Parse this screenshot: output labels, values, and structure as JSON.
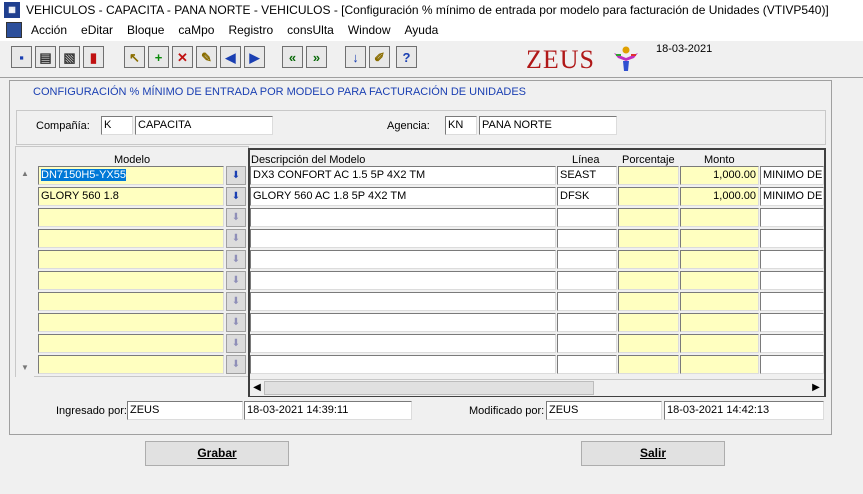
{
  "window": {
    "title": "VEHICULOS - CAPACITA - PANA NORTE - VEHICULOS - [Configuración % mínimo de entrada por modelo para facturación de Unidades (VTIVP540)]"
  },
  "menu": [
    "Acción",
    "eDitar",
    "Bloque",
    "caMpo",
    "Registro",
    "consUlta",
    "Window",
    "Ayuda"
  ],
  "toolbar": {
    "buttons": [
      {
        "icon": "save-icon",
        "glyph": "▪"
      },
      {
        "icon": "print-icon",
        "glyph": "▤"
      },
      {
        "icon": "print-preview-icon",
        "glyph": "▧"
      },
      {
        "icon": "exit-icon",
        "glyph": "▮"
      },
      {
        "icon": "query-icon",
        "glyph": "↖"
      },
      {
        "icon": "insert-record-icon",
        "glyph": "+"
      },
      {
        "icon": "delete-record-icon",
        "glyph": "✕"
      },
      {
        "icon": "clear-icon",
        "glyph": "✎"
      },
      {
        "icon": "previous-record-icon",
        "glyph": "◀"
      },
      {
        "icon": "next-record-icon",
        "glyph": "▶"
      },
      {
        "icon": "previous-block-icon",
        "glyph": "«"
      },
      {
        "icon": "next-block-icon",
        "glyph": "»"
      },
      {
        "icon": "list-values-icon",
        "glyph": "↓"
      },
      {
        "icon": "edit-icon",
        "glyph": "✐"
      },
      {
        "icon": "help-icon",
        "glyph": "?"
      }
    ],
    "brand": "ZEUS",
    "date": "18-03-2021"
  },
  "form": {
    "heading": "CONFIGURACIÓN % MÍNIMO DE ENTRADA POR MODELO PARA FACTURACIÓN DE UNIDADES",
    "compania_label": "Compañía:",
    "compania_code": "K",
    "compania_name": "CAPACITA",
    "agencia_label": "Agencia:",
    "agencia_code": "KN",
    "agencia_name": "PANA NORTE"
  },
  "grid": {
    "headers": {
      "modelo": "Modelo",
      "descripcion": "Descripción del Modelo",
      "linea": "Línea",
      "porcentaje": "Porcentaje",
      "monto": "Monto"
    },
    "rows": [
      {
        "modelo": "DN7150H5-YX55",
        "descripcion": "DX3 CONFORT AC 1.5 5P 4X2 TM",
        "linea": "SEAST",
        "porcentaje": "",
        "monto": "1,000.00",
        "tipo": "MINIMO DE E"
      },
      {
        "modelo": "GLORY 560 1.8",
        "descripcion": "GLORY 560 AC 1.8 5P 4X2 TM",
        "linea": "DFSK",
        "porcentaje": "",
        "monto": "1,000.00",
        "tipo": "MINIMO DE E"
      },
      {
        "modelo": "",
        "descripcion": "",
        "linea": "",
        "porcentaje": "",
        "monto": "",
        "tipo": ""
      },
      {
        "modelo": "",
        "descripcion": "",
        "linea": "",
        "porcentaje": "",
        "monto": "",
        "tipo": ""
      },
      {
        "modelo": "",
        "descripcion": "",
        "linea": "",
        "porcentaje": "",
        "monto": "",
        "tipo": ""
      },
      {
        "modelo": "",
        "descripcion": "",
        "linea": "",
        "porcentaje": "",
        "monto": "",
        "tipo": ""
      },
      {
        "modelo": "",
        "descripcion": "",
        "linea": "",
        "porcentaje": "",
        "monto": "",
        "tipo": ""
      },
      {
        "modelo": "",
        "descripcion": "",
        "linea": "",
        "porcentaje": "",
        "monto": "",
        "tipo": ""
      },
      {
        "modelo": "",
        "descripcion": "",
        "linea": "",
        "porcentaje": "",
        "monto": "",
        "tipo": ""
      },
      {
        "modelo": "",
        "descripcion": "",
        "linea": "",
        "porcentaje": "",
        "monto": "",
        "tipo": ""
      }
    ]
  },
  "audit": {
    "ingresado_label": "Ingresado por:",
    "ingresado_user": "ZEUS",
    "ingresado_date": "18-03-2021 14:39:11",
    "modificado_label": "Modificado por:",
    "modificado_user": "ZEUS",
    "modificado_date": "18-03-2021 14:42:13"
  },
  "actions": {
    "grabar": "Grabar",
    "salir": "Salir"
  },
  "colors": {
    "heading": "#1a3fb2",
    "brand": "#b01818",
    "field_yellow": "#ffffc0",
    "selection": "#0078d7"
  }
}
